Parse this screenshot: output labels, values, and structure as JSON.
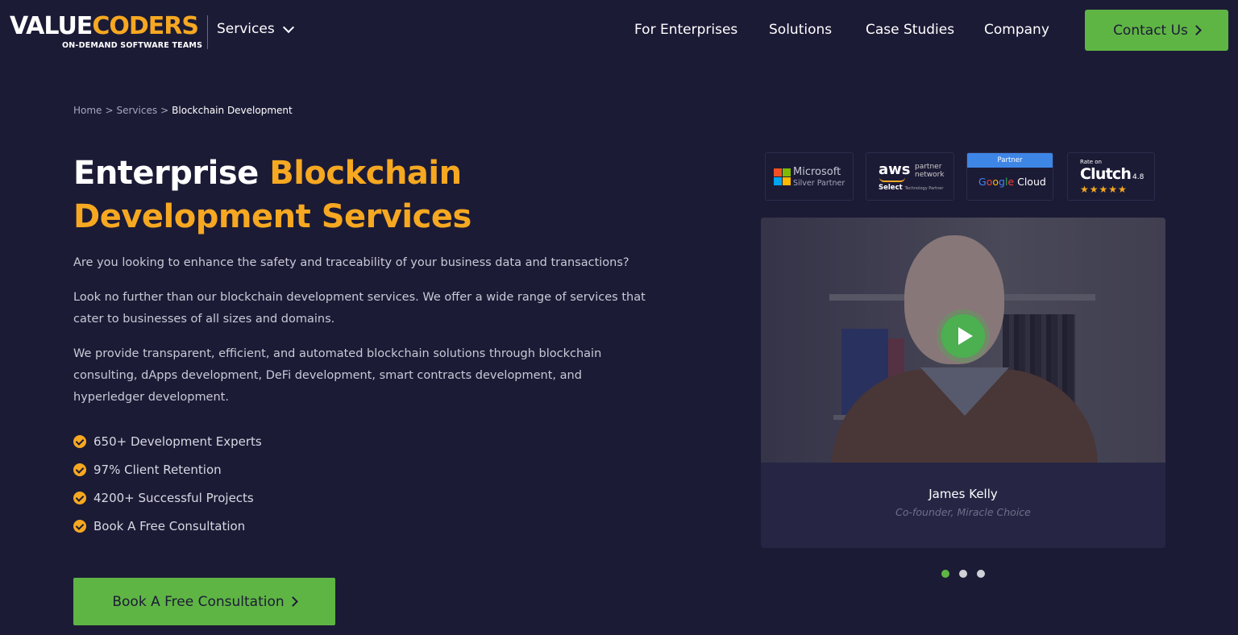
{
  "header": {
    "logo_main_1": "VALUE",
    "logo_main_2": "CODERS",
    "logo_sub": "ON-DEMAND SOFTWARE TEAMS",
    "services_label": "Services",
    "nav": [
      "For Enterprises",
      "Solutions",
      "Case Studies",
      "Company"
    ],
    "contact_label": "Contact Us"
  },
  "breadcrumb": {
    "home": "Home",
    "services": "Services",
    "current": "Blockchain Development",
    "separator": ">"
  },
  "hero": {
    "title_plain": "Enterprise",
    "title_highlight": "Blockchain Development Services",
    "paragraphs": [
      "Are you looking to enhance the safety and traceability of your business data and transactions?",
      "Look no further than our blockchain development services. We offer a wide range of services that cater to businesses of all sizes and domains.",
      "We provide transparent, efficient, and automated blockchain solutions through blockchain consulting, dApps development, DeFi development, smart contracts development, and hyperledger development."
    ],
    "features": [
      "650+ Development Experts",
      "97% Client Retention",
      "4200+ Successful Projects",
      "Book A Free Consultation"
    ],
    "cta_label": "Book A Free Consultation"
  },
  "badges": {
    "microsoft": {
      "name": "Microsoft",
      "tier": "Silver Partner"
    },
    "aws": {
      "word": "aws",
      "partner": "partner",
      "network": "network",
      "select": "Select",
      "select_small": "Technology Partner"
    },
    "google": {
      "top": "Partner",
      "g": [
        "G",
        "o",
        "o",
        "g",
        "l",
        "e"
      ],
      "cloud": "Cloud"
    },
    "clutch": {
      "rate_on": "Rate on",
      "name": "Clutch",
      "score": "4.8",
      "stars": "★★★★★"
    }
  },
  "testimonial": {
    "name": "James Kelly",
    "role": "Co-founder, Miracle Choice",
    "slide_count": 3,
    "active_slide": 1
  },
  "colors": {
    "background": "#1c1b36",
    "accent_orange": "#f6a821",
    "accent_green": "#5fb544",
    "card": "#262644"
  },
  "icons": [
    "chevron-down-icon",
    "chevron-right-icon",
    "check-circle-icon",
    "play-icon",
    "microsoft-logo-icon"
  ]
}
